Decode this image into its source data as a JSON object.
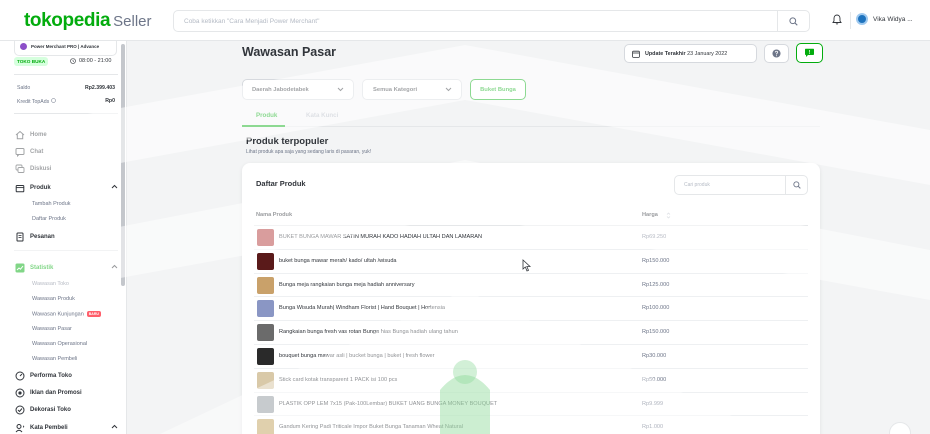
{
  "header": {
    "logo_main": "tokopedia",
    "logo_sub": "Seller",
    "search_placeholder": "Coba ketikkan \"Cara Menjadi Power Merchant\"",
    "user_name": "Vika Widya ..."
  },
  "sidebar": {
    "badge": "Power Merchant PRO | Advance",
    "store_status": "TOKO BUKA",
    "store_hours": "08:00 - 21:00",
    "balance_label": "Saldo",
    "balance_value": "Rp2.399.403",
    "topads_label": "Kredit TopAds",
    "topads_value": "Rp0",
    "nav": [
      {
        "label": "Home"
      },
      {
        "label": "Chat"
      },
      {
        "label": "Diskusi"
      },
      {
        "label": "Produk"
      },
      {
        "label": "Pesanan"
      },
      {
        "label": "Statistik"
      },
      {
        "label": "Performa Toko"
      },
      {
        "label": "Iklan dan Promosi"
      },
      {
        "label": "Dekorasi Toko"
      },
      {
        "label": "Kata Pembeli"
      }
    ],
    "produk_sub": [
      "Tambah Produk",
      "Daftar Produk"
    ],
    "statistik_sub": [
      "Wawasan Toko",
      "Wawasan Produk",
      "Wawasan Kunjungan",
      "Wawasan Pasar",
      "Wawasan Operasional",
      "Wawasan Pembeli"
    ],
    "new_badge": "BARU"
  },
  "main": {
    "title": "Wawasan Pasar",
    "update_label": "Update Terakhir",
    "update_date": "23 January 2022",
    "filters": {
      "region": "Daerah Jabodetabek",
      "category": "Semua Kategori",
      "keyword_button": "Buket Bunga"
    },
    "tabs": [
      "Produk",
      "Kata Kunci"
    ],
    "section_title": "Produk terpopuler",
    "section_subtitle": "Lihat produk apa saja yang sedang laris di pasaran, yuk!",
    "card_title": "Daftar Produk",
    "card_search_placeholder": "Cari produk",
    "table": {
      "headers": [
        "Nama Produk",
        "Harga"
      ],
      "rows": [
        {
          "name": "BUKET BUNGA MAWAR SATIN MURAH KADO HADIAH ULTAH DAN LAMARAN",
          "price": "Rp69.250",
          "thumb": "#b33a3a"
        },
        {
          "name": "buket bunga mawar merah/ kado/ ultah /wisuda",
          "price": "Rp150.000",
          "thumb": "#5a1a1a"
        },
        {
          "name": "Bunga meja rangkaian bunga meja hadiah anniversary",
          "price": "Rp125.000",
          "thumb": "#c9a16a"
        },
        {
          "name": "Bunga Wisuda Murah| Windham Florist | Hand Bouquet | Hortensia",
          "price": "Rp100.000",
          "thumb": "#8a96c4"
        },
        {
          "name": "Rangkaian bunga fresh vas rotan Bunga hias Bunga hadiah ulang tahun",
          "price": "Rp150.000",
          "thumb": "#6b6b6b"
        },
        {
          "name": "bouquet bunga mawar asli | bucket bunga | buket | fresh flower",
          "price": "Rp30.000",
          "thumb": "#2a2a2a"
        },
        {
          "name": "Stick card kotak transparent 1 PACK isi 100 pcs",
          "price": "Rp50.000",
          "thumb": "#d9c9a8"
        },
        {
          "name": "PLASTIK OPP LEM 7x15 (Pak-100Lembar) BUKET UANG BUNGA MONEY BOUQUET",
          "price": "Rp9.999",
          "thumb": "#9aa0a6"
        },
        {
          "name": "Gandum Kering Padi Triticale Impor Buket Bunga Tanaman Wheat Natural",
          "price": "Rp1.000",
          "thumb": "#c7a96b"
        }
      ]
    }
  },
  "colors": {
    "brand_green": "#03ac0e",
    "text_dark": "#31353b",
    "text_muted": "#6d7588",
    "border": "#e5e7e9"
  }
}
